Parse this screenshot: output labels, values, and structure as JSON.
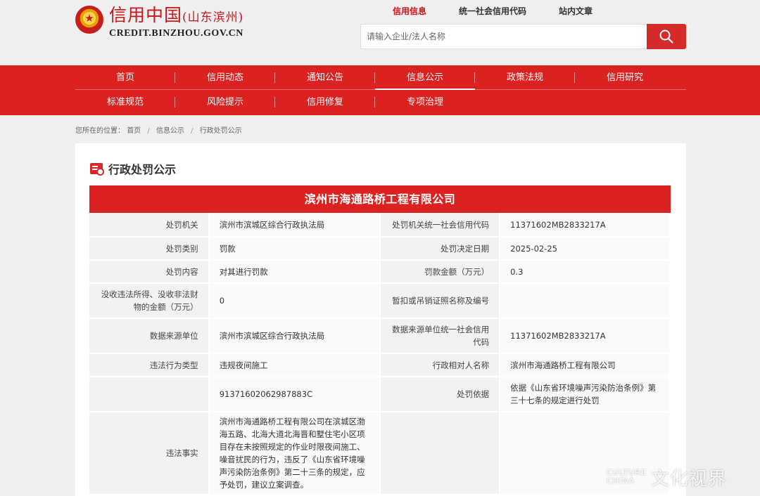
{
  "header": {
    "logo_title": "信用中国",
    "logo_region": "(山东滨州)",
    "logo_url": "CREDIT.BINZHOU.GOV.CN",
    "top_links": [
      "信用信息",
      "统一社会信用代码",
      "站内文章"
    ],
    "search": {
      "placeholder": "请输入企业/法人名称"
    },
    "icons": {
      "search": "search-icon",
      "emblem": "national-emblem-icon"
    }
  },
  "nav": {
    "row1": [
      "首页",
      "信用动态",
      "通知公告",
      "信息公示",
      "政策法规",
      "信用研究"
    ],
    "row2": [
      "标准规范",
      "风险提示",
      "信用修复",
      "专项治理"
    ],
    "active": "信息公示",
    "colors": {
      "nav_bg": "#dc2121",
      "brand": "#c8161d"
    }
  },
  "breadcrumb": {
    "prefix": "您所在的位置：",
    "items": [
      "首页",
      "信息公示",
      "行政处罚公示"
    ]
  },
  "panel": {
    "title": "行政处罚公示",
    "company": "滨州市海通路桥工程有限公司",
    "rows": [
      {
        "l1": "处罚机关",
        "v1": "滨州市滨城区综合行政执法局",
        "l2": "处罚机关统一社会信用代码",
        "v2": "11371602MB2833217A"
      },
      {
        "l1": "处罚类别",
        "v1": "罚款",
        "l2": "处罚决定日期",
        "v2": "2025-02-25"
      },
      {
        "l1": "处罚内容",
        "v1": "对其进行罚款",
        "l2": "罚款金额（万元）",
        "v2": "0.3"
      },
      {
        "l1": "没收违法所得、没收非法财物的金额（万元）",
        "v1": "0",
        "l2": "暂扣或吊销证照名称及编号",
        "v2": ""
      },
      {
        "l1": "数据来源单位",
        "v1": "滨州市滨城区综合行政执法局",
        "l2": "数据来源单位统一社会信用代码",
        "v2": "11371602MB2833217A"
      },
      {
        "l1": "违法行为类型",
        "v1": "违规夜间施工",
        "l2": "行政相对人名称",
        "v2": "滨州市海通路桥工程有限公司"
      },
      {
        "l1": "",
        "v1": "91371602062987883C",
        "l2": "处罚依据",
        "v2": "依据《山东省环境噪声污染防治条例》第三十七条的规定进行处罚"
      },
      {
        "l1": "违法事实",
        "v1": "滨州市海通路桥工程有限公司在滨城区渤海五路、北海大道北海晋和墅住宅小区项目存在未按照规定的作业时限夜间施工、噪音扰民的行为，违反了《山东省环境噪声污染防治条例》第二十三条的规定，应予处罚，建议立案调查。",
        "l2": "",
        "v2": ""
      }
    ]
  },
  "watermark": {
    "latin_top": "CULTURE",
    "latin_bottom": "CHINA",
    "cn": "文化视界"
  }
}
